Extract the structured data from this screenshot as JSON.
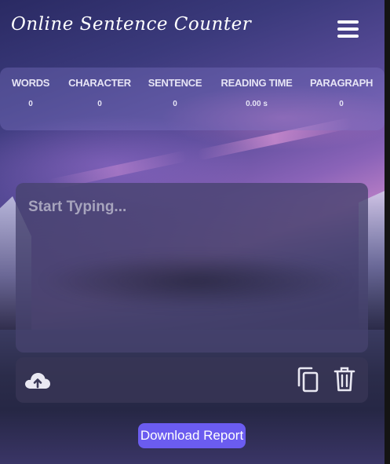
{
  "header": {
    "title": "Online Sentence Counter",
    "menu_icon": "hamburger-menu-icon"
  },
  "stats": [
    {
      "label": "WORDS",
      "value": "0"
    },
    {
      "label": "CHARACTER",
      "value": "0"
    },
    {
      "label": "SENTENCE",
      "value": "0"
    },
    {
      "label": "READING TIME",
      "value": "0.00 s"
    },
    {
      "label": "PARAGRAPH",
      "value": "0"
    }
  ],
  "editor": {
    "placeholder": "Start Typing...",
    "value": ""
  },
  "toolbar": {
    "upload_icon": "cloud-upload-icon",
    "copy_icon": "copy-icon",
    "delete_icon": "trash-icon"
  },
  "download": {
    "label": "Download Report",
    "color": "#6b5cf0"
  }
}
